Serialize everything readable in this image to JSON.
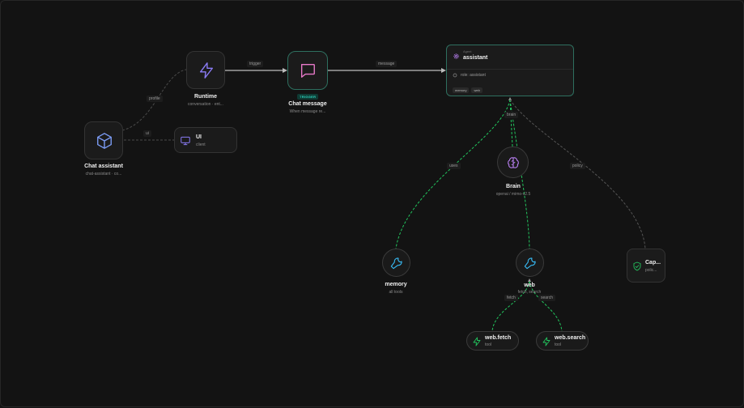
{
  "nodes": {
    "chat_assistant": {
      "title": "Chat assistant",
      "subtitle": "chat-assistant · co..."
    },
    "runtime": {
      "title": "Runtime",
      "subtitle": "conversation · ent..."
    },
    "ui": {
      "title": "UI",
      "subtitle": "client"
    },
    "chat_message": {
      "badge": "TRIGGER",
      "title": "Chat message",
      "subtitle": "When message re..."
    },
    "agent": {
      "kind": "Agent",
      "title": "assistant",
      "role": "role: assistant",
      "tags": [
        "memory",
        "web"
      ]
    },
    "brain": {
      "title": "Brain",
      "subtitle": "openai / mimo-v2.5"
    },
    "memory": {
      "title": "memory",
      "subtitle": "all tools"
    },
    "web": {
      "title": "web",
      "subtitle": "fetch, search"
    },
    "capabilities": {
      "title": "Cap...",
      "subtitle": "polic..."
    },
    "web_fetch": {
      "title": "web.fetch",
      "subtitle": "tool"
    },
    "web_search": {
      "title": "web.search",
      "subtitle": "tool"
    }
  },
  "edge_labels": {
    "profile": "profile",
    "ui": "ui",
    "trigger": "trigger",
    "message": "message",
    "brain": "brain",
    "uses": "uses",
    "policy": "policy",
    "fetch": "fetch",
    "search": "search"
  },
  "colors": {
    "background": "#131313",
    "accent_green": "#22c55e",
    "trigger_teal": "#2dd4bf",
    "runtime_purple": "#8b7cf6",
    "chat_pink": "#e879c9",
    "tool_blue": "#38bdf8",
    "brain_violet": "#c084fc"
  }
}
